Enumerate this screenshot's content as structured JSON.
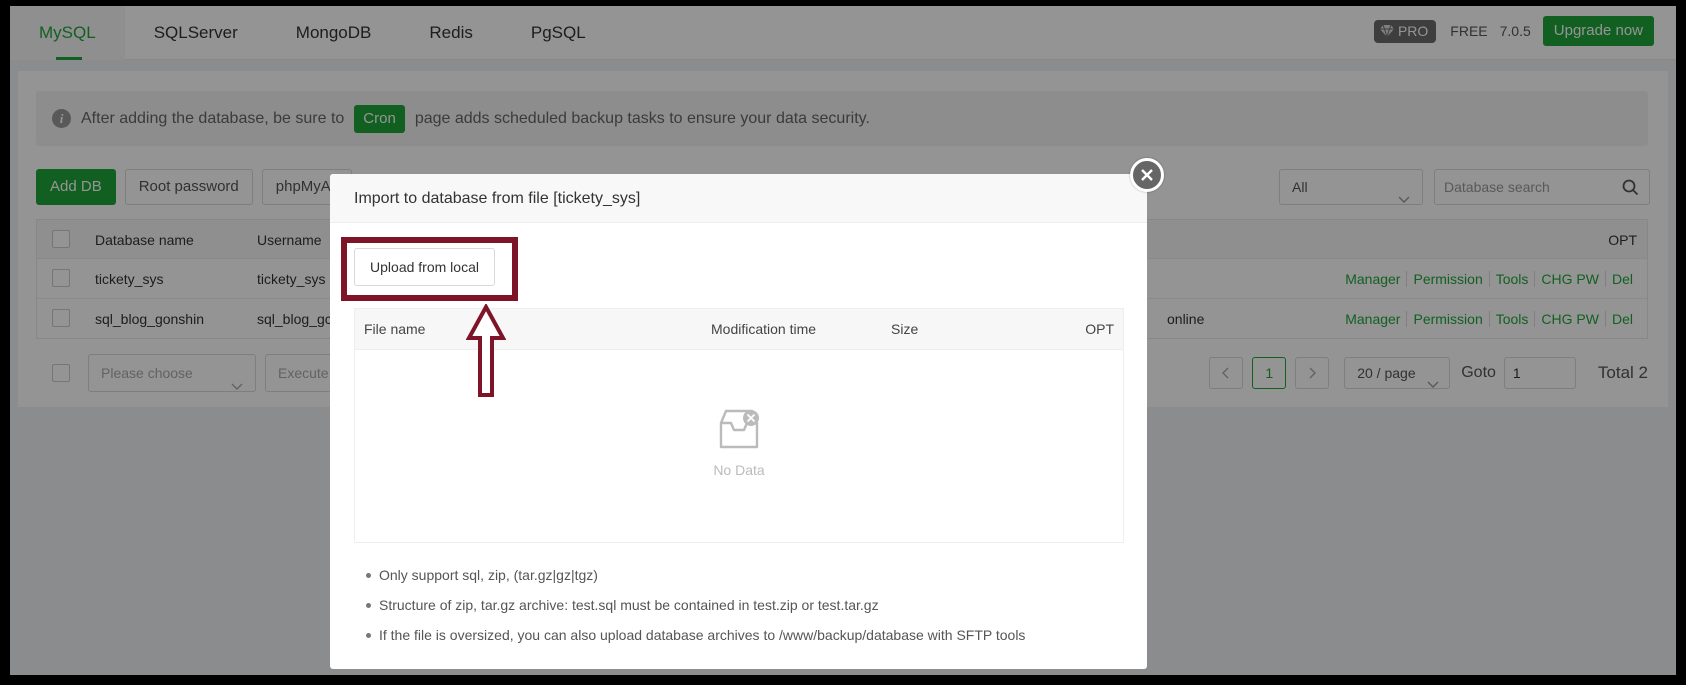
{
  "nav": {
    "tabs": [
      {
        "label": "MySQL",
        "active": true
      },
      {
        "label": "SQLServer"
      },
      {
        "label": "MongoDB"
      },
      {
        "label": "Redis"
      },
      {
        "label": "PgSQL"
      }
    ],
    "pro_label": "PRO",
    "free_label": "FREE",
    "version": "7.0.5",
    "upgrade_label": "Upgrade now"
  },
  "tip": {
    "before": "After adding the database, be sure to",
    "cron_label": "Cron",
    "after": "page adds scheduled backup tasks to ensure your data security."
  },
  "toolbar": {
    "add_db": "Add DB",
    "root_password": "Root password",
    "phpmyadmin": "phpMyAc",
    "filter_value": "All",
    "search_placeholder": "Database search"
  },
  "table": {
    "headers": {
      "name": "Database name",
      "user": "Username",
      "opt": "OPT"
    },
    "rows": [
      {
        "name": "tickety_sys",
        "user": "tickety_sys",
        "status": ""
      },
      {
        "name": "sql_blog_gonshin",
        "user": "sql_blog_gc",
        "status": "online"
      }
    ],
    "ops": [
      "Manager",
      "Permission",
      "Tools",
      "CHG PW",
      "Del"
    ]
  },
  "bottom": {
    "batch_placeholder": "Please choose",
    "execute_label": "Execute",
    "current_page": "1",
    "page_size": "20 / page",
    "goto_label": "Goto",
    "goto_value": "1",
    "total": "Total 2"
  },
  "modal": {
    "title": "Import to database from file [tickety_sys]",
    "upload_label": "Upload from local",
    "headers": {
      "name": "File name",
      "mod": "Modification time",
      "size": "Size",
      "opt": "OPT"
    },
    "no_data": "No Data",
    "notes": [
      "Only support sql, zip, (tar.gz|gz|tgz)",
      "Structure of zip, tar.gz archive: test.sql must be contained in test.zip or test.tar.gz",
      "If the file is oversized, you can also upload database archives to /www/backup/database with SFTP tools"
    ]
  },
  "colors": {
    "accent": "#20a53a",
    "highlight": "#7d1428"
  }
}
